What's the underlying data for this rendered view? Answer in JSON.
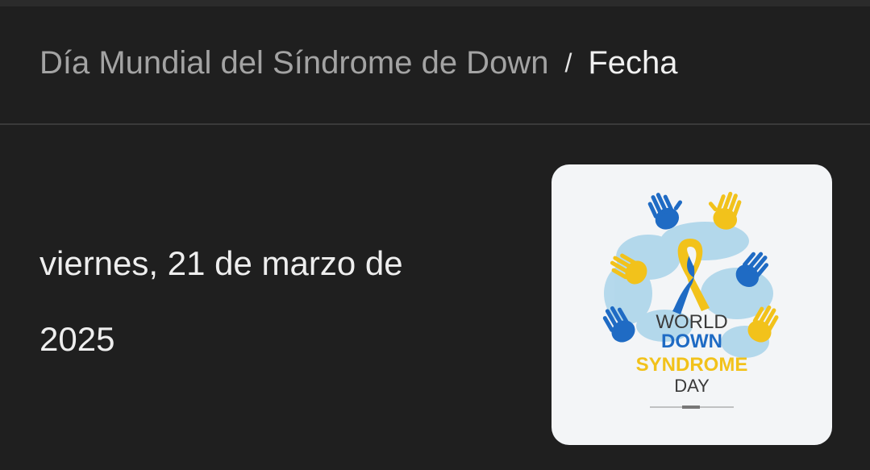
{
  "breadcrumb": {
    "parent": "Día Mundial del Síndrome de Down",
    "separator": "/",
    "current": "Fecha"
  },
  "event": {
    "date_line1": "viernes, 21 de marzo de",
    "date_line2": "2025"
  },
  "image": {
    "line1": "WORLD",
    "line2": "DOWN",
    "line3": "SYNDROME",
    "line4": "DAY"
  },
  "colors": {
    "background": "#1f1f1f",
    "blue": "#1f6bc4",
    "yellow": "#f2c21b"
  }
}
